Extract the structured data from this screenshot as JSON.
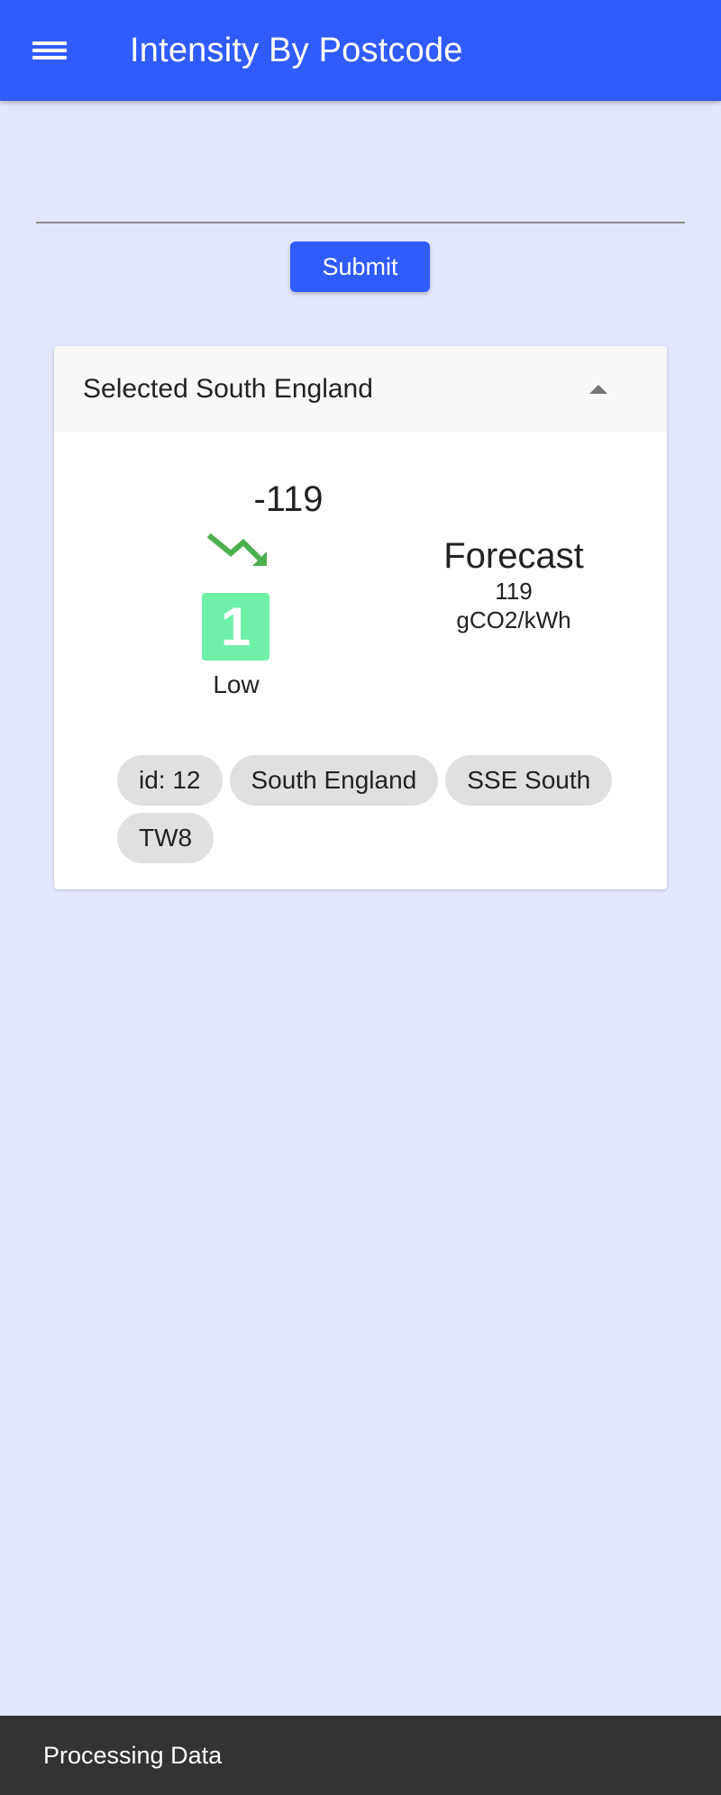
{
  "app_bar": {
    "title": "Intensity By Postcode",
    "menu_icon": "hamburger-menu-icon",
    "color": "#305cfd"
  },
  "search": {
    "value": "",
    "placeholder": ""
  },
  "form": {
    "submit_label": "Submit"
  },
  "result_card": {
    "header": "Selected South England",
    "header_icon": "caret-up-icon",
    "delta": "-119",
    "trend_icon": "trending-down-icon",
    "trend_color": "#4caf50",
    "index_value": "1",
    "index_label": "Low",
    "index_color": "#6ef0a8",
    "forecast_title": "Forecast",
    "forecast_value": "119",
    "forecast_unit": "gCO2/kWh",
    "chips": [
      "id: 12",
      "South England",
      "SSE South",
      "TW8"
    ]
  },
  "snackbar": {
    "message": "Processing Data"
  }
}
